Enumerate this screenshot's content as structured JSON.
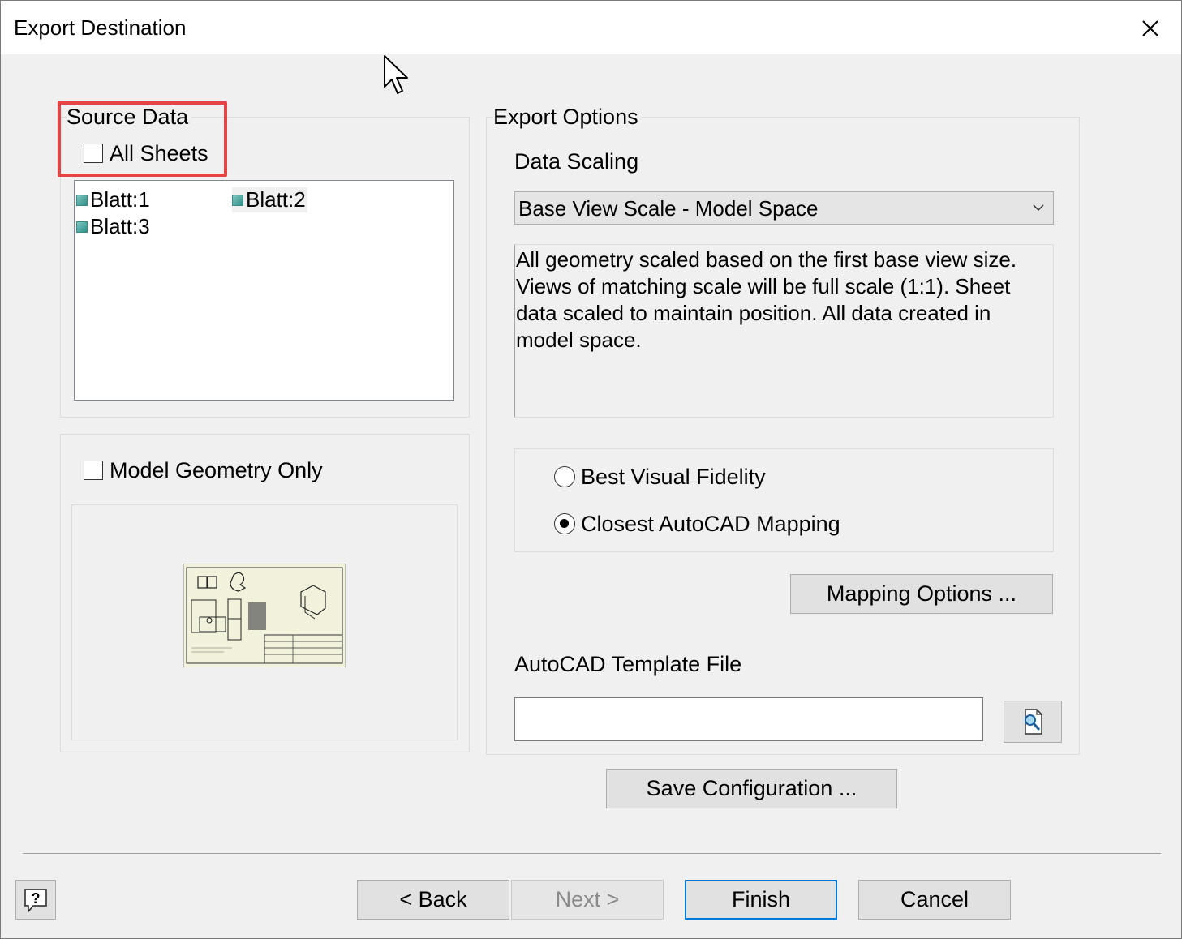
{
  "window": {
    "title": "Export Destination"
  },
  "source_data": {
    "title": "Source Data",
    "all_sheets_label": "All Sheets",
    "all_sheets_checked": false,
    "sheets": [
      "Blatt:1",
      "Blatt:2",
      "Blatt:3"
    ]
  },
  "model_geometry": {
    "label": "Model Geometry Only",
    "checked": false
  },
  "export_options": {
    "title": "Export Options",
    "data_scaling_label": "Data Scaling",
    "data_scaling_value": "Base View Scale - Model Space",
    "description": "All geometry scaled based on the first base view size.\nViews of matching scale will be full scale (1:1). Sheet\ndata scaled to maintain position. All data created in\nmodel space.",
    "radio_best_visual": "Best Visual Fidelity",
    "radio_closest_autocad": "Closest AutoCAD Mapping",
    "selected_radio": "Closest AutoCAD Mapping",
    "mapping_options_button": "Mapping Options ...",
    "template_label": "AutoCAD Template File",
    "template_value": ""
  },
  "save_configuration_button": "Save Configuration ...",
  "footer": {
    "back": "< Back",
    "next": "Next >",
    "finish": "Finish",
    "cancel": "Cancel"
  },
  "colors": {
    "highlight": "#e64444",
    "default_button_border": "#0078d7",
    "dialog_bg": "#f0f0f0"
  },
  "icons": [
    "close-icon",
    "sheet-icon",
    "browse-file-icon",
    "help-icon",
    "mouse-cursor-icon",
    "chevron-down-icon"
  ]
}
